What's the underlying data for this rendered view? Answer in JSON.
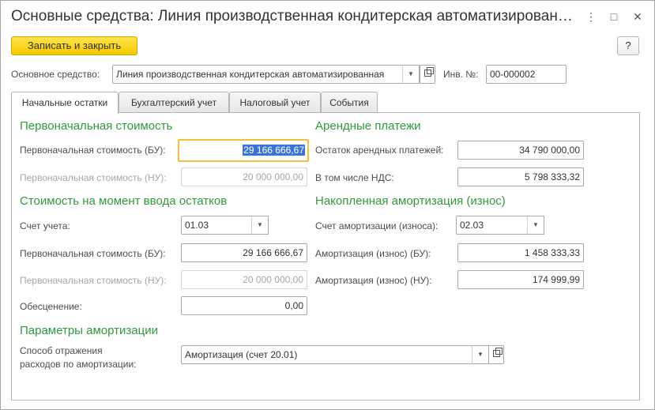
{
  "window": {
    "title": "Основные средства: Линия производственная кондитерская автоматизирован…",
    "more_icon": "⋮",
    "maximize_icon": "□",
    "close_icon": "✕"
  },
  "toolbar": {
    "save_close_label": "Записать и закрыть",
    "help_label": "?"
  },
  "header": {
    "asset_label": "Основное средство:",
    "asset_value": "Линия производственная кондитерская автоматизированная",
    "inv_label": "Инв. №:",
    "inv_value": "00-000002"
  },
  "tabs": [
    {
      "label": "Начальные остатки",
      "active": true
    },
    {
      "label": "Бухгалтерский учет",
      "active": false
    },
    {
      "label": "Налоговый учет",
      "active": false
    },
    {
      "label": "События",
      "active": false
    }
  ],
  "left": {
    "section1_title": "Первоначальная стоимость",
    "initial_cost_bu_label": "Первоначальная стоимость (БУ):",
    "initial_cost_bu_value": "29 166 666,67",
    "initial_cost_nu_label": "Первоначальная стоимость (НУ):",
    "initial_cost_nu_value": "20 000 000,00",
    "section2_title": "Стоимость на момент ввода остатков",
    "account_label": "Счет учета:",
    "account_value": "01.03",
    "cost_bu_label": "Первоначальная стоимость (БУ):",
    "cost_bu_value": "29 166 666,67",
    "cost_nu_label": "Первоначальная стоимость (НУ):",
    "cost_nu_value": "20 000 000,00",
    "impairment_label": "Обесценение:",
    "impairment_value": "0,00",
    "section3_title": "Параметры амортизации",
    "expense_label_line1": "Способ отражения",
    "expense_label_line2": "расходов по амортизации:",
    "expense_value": "Амортизация (счет 20.01)"
  },
  "right": {
    "section1_title": "Арендные платежи",
    "lease_balance_label": "Остаток арендных платежей:",
    "lease_balance_value": "34 790 000,00",
    "vat_label": "В том числе НДС:",
    "vat_value": "5 798 333,32",
    "section2_title": "Накопленная амортизация (износ)",
    "depr_account_label": "Счет амортизации (износа):",
    "depr_account_value": "02.03",
    "depr_bu_label": "Амортизация (износ) (БУ):",
    "depr_bu_value": "1 458 333,33",
    "depr_nu_label": "Амортизация (износ) (НУ):",
    "depr_nu_value": "174 999,99"
  },
  "icons": {
    "dropdown": "chevron-down-icon",
    "open": "open-form-icon"
  }
}
